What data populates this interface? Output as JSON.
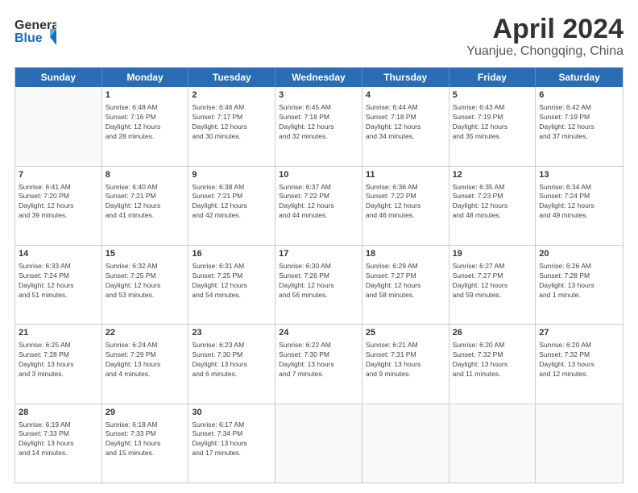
{
  "header": {
    "logo_line1": "General",
    "logo_line2": "Blue",
    "title": "April 2024",
    "location": "Yuanjue, Chongqing, China"
  },
  "days_of_week": [
    "Sunday",
    "Monday",
    "Tuesday",
    "Wednesday",
    "Thursday",
    "Friday",
    "Saturday"
  ],
  "weeks": [
    [
      {
        "day": "",
        "info": ""
      },
      {
        "day": "1",
        "info": "Sunrise: 6:48 AM\nSunset: 7:16 PM\nDaylight: 12 hours\nand 28 minutes."
      },
      {
        "day": "2",
        "info": "Sunrise: 6:46 AM\nSunset: 7:17 PM\nDaylight: 12 hours\nand 30 minutes."
      },
      {
        "day": "3",
        "info": "Sunrise: 6:45 AM\nSunset: 7:18 PM\nDaylight: 12 hours\nand 32 minutes."
      },
      {
        "day": "4",
        "info": "Sunrise: 6:44 AM\nSunset: 7:18 PM\nDaylight: 12 hours\nand 34 minutes."
      },
      {
        "day": "5",
        "info": "Sunrise: 6:43 AM\nSunset: 7:19 PM\nDaylight: 12 hours\nand 35 minutes."
      },
      {
        "day": "6",
        "info": "Sunrise: 6:42 AM\nSunset: 7:19 PM\nDaylight: 12 hours\nand 37 minutes."
      }
    ],
    [
      {
        "day": "7",
        "info": "Sunrise: 6:41 AM\nSunset: 7:20 PM\nDaylight: 12 hours\nand 39 minutes."
      },
      {
        "day": "8",
        "info": "Sunrise: 6:40 AM\nSunset: 7:21 PM\nDaylight: 12 hours\nand 41 minutes."
      },
      {
        "day": "9",
        "info": "Sunrise: 6:38 AM\nSunset: 7:21 PM\nDaylight: 12 hours\nand 42 minutes."
      },
      {
        "day": "10",
        "info": "Sunrise: 6:37 AM\nSunset: 7:22 PM\nDaylight: 12 hours\nand 44 minutes."
      },
      {
        "day": "11",
        "info": "Sunrise: 6:36 AM\nSunset: 7:22 PM\nDaylight: 12 hours\nand 46 minutes."
      },
      {
        "day": "12",
        "info": "Sunrise: 6:35 AM\nSunset: 7:23 PM\nDaylight: 12 hours\nand 48 minutes."
      },
      {
        "day": "13",
        "info": "Sunrise: 6:34 AM\nSunset: 7:24 PM\nDaylight: 12 hours\nand 49 minutes."
      }
    ],
    [
      {
        "day": "14",
        "info": "Sunrise: 6:33 AM\nSunset: 7:24 PM\nDaylight: 12 hours\nand 51 minutes."
      },
      {
        "day": "15",
        "info": "Sunrise: 6:32 AM\nSunset: 7:25 PM\nDaylight: 12 hours\nand 53 minutes."
      },
      {
        "day": "16",
        "info": "Sunrise: 6:31 AM\nSunset: 7:25 PM\nDaylight: 12 hours\nand 54 minutes."
      },
      {
        "day": "17",
        "info": "Sunrise: 6:30 AM\nSunset: 7:26 PM\nDaylight: 12 hours\nand 56 minutes."
      },
      {
        "day": "18",
        "info": "Sunrise: 6:29 AM\nSunset: 7:27 PM\nDaylight: 12 hours\nand 58 minutes."
      },
      {
        "day": "19",
        "info": "Sunrise: 6:27 AM\nSunset: 7:27 PM\nDaylight: 12 hours\nand 59 minutes."
      },
      {
        "day": "20",
        "info": "Sunrise: 6:26 AM\nSunset: 7:28 PM\nDaylight: 13 hours\nand 1 minute."
      }
    ],
    [
      {
        "day": "21",
        "info": "Sunrise: 6:25 AM\nSunset: 7:28 PM\nDaylight: 13 hours\nand 3 minutes."
      },
      {
        "day": "22",
        "info": "Sunrise: 6:24 AM\nSunset: 7:29 PM\nDaylight: 13 hours\nand 4 minutes."
      },
      {
        "day": "23",
        "info": "Sunrise: 6:23 AM\nSunset: 7:30 PM\nDaylight: 13 hours\nand 6 minutes."
      },
      {
        "day": "24",
        "info": "Sunrise: 6:22 AM\nSunset: 7:30 PM\nDaylight: 13 hours\nand 7 minutes."
      },
      {
        "day": "25",
        "info": "Sunrise: 6:21 AM\nSunset: 7:31 PM\nDaylight: 13 hours\nand 9 minutes."
      },
      {
        "day": "26",
        "info": "Sunrise: 6:20 AM\nSunset: 7:32 PM\nDaylight: 13 hours\nand 11 minutes."
      },
      {
        "day": "27",
        "info": "Sunrise: 6:20 AM\nSunset: 7:32 PM\nDaylight: 13 hours\nand 12 minutes."
      }
    ],
    [
      {
        "day": "28",
        "info": "Sunrise: 6:19 AM\nSunset: 7:33 PM\nDaylight: 13 hours\nand 14 minutes."
      },
      {
        "day": "29",
        "info": "Sunrise: 6:18 AM\nSunset: 7:33 PM\nDaylight: 13 hours\nand 15 minutes."
      },
      {
        "day": "30",
        "info": "Sunrise: 6:17 AM\nSunset: 7:34 PM\nDaylight: 13 hours\nand 17 minutes."
      },
      {
        "day": "",
        "info": ""
      },
      {
        "day": "",
        "info": ""
      },
      {
        "day": "",
        "info": ""
      },
      {
        "day": "",
        "info": ""
      }
    ]
  ]
}
